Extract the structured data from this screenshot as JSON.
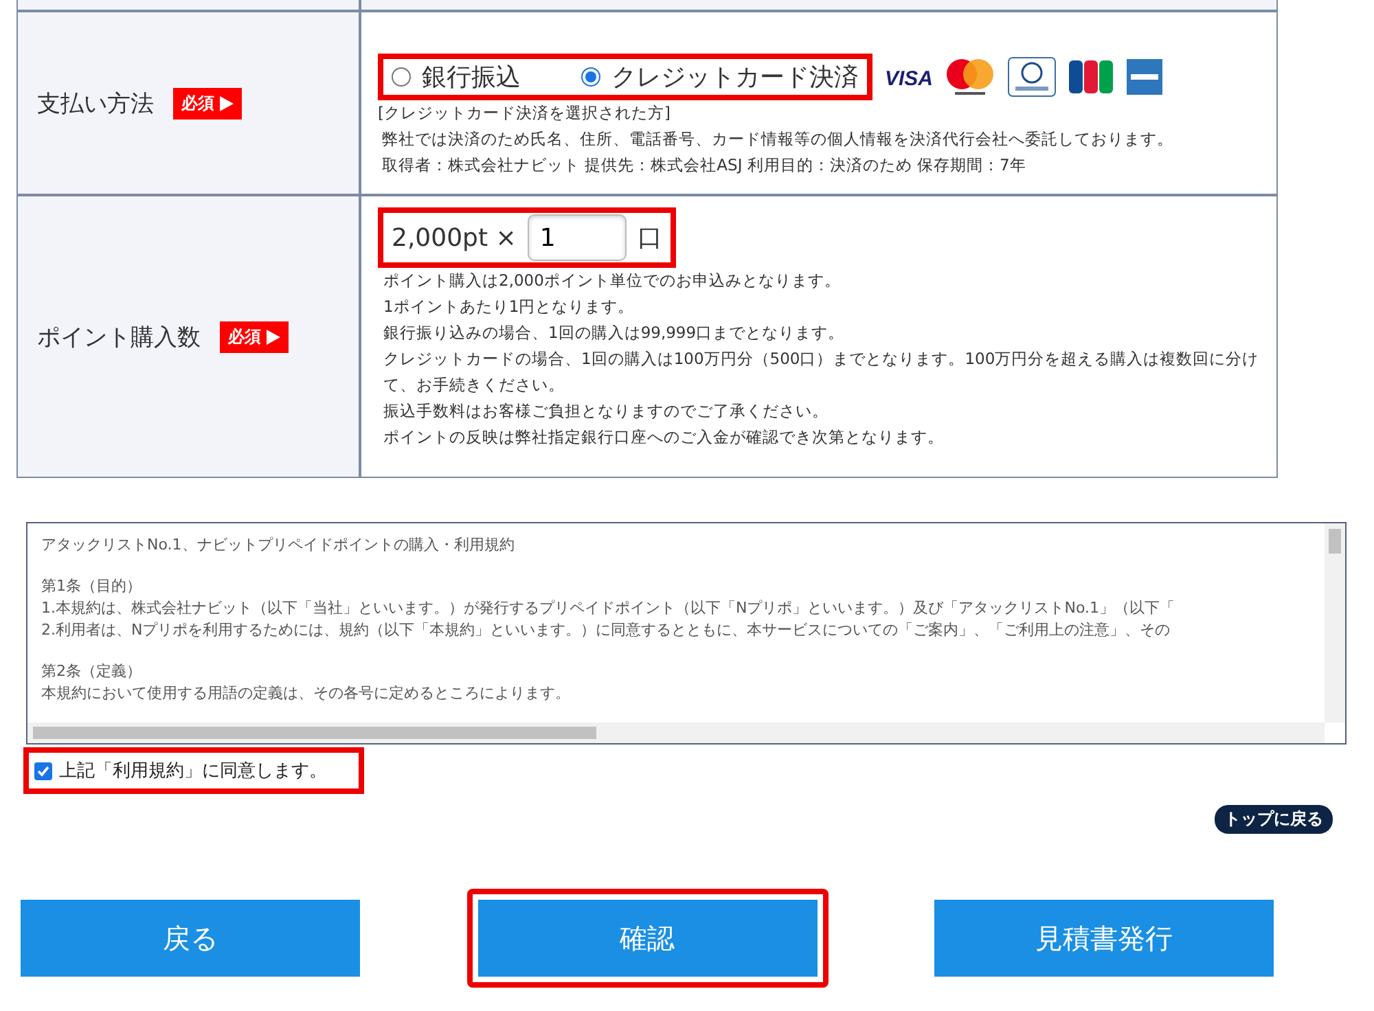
{
  "form_rows": [
    {
      "kind": "payment",
      "label": "支払い方法",
      "required_badge": "必須",
      "options": [
        {
          "label": "銀行振込",
          "selected": false
        },
        {
          "label": "クレジットカード決済",
          "selected": true
        }
      ],
      "card_logos": [
        {
          "kind": "visa",
          "label": "VISA"
        },
        {
          "kind": "mastercard"
        },
        {
          "kind": "diners"
        },
        {
          "kind": "jcb"
        },
        {
          "kind": "amex"
        }
      ],
      "notes": [
        "[クレジットカード決済を選択された方]",
        "弊社では決済のため氏名、住所、電話番号、カード情報等の個人情報を決済代行会社へ委託しております。",
        "取得者：株式会社ナビット 提供先：株式会社ASJ 利用目的：決済のため 保存期間：7年"
      ]
    },
    {
      "kind": "quantity",
      "label": "ポイント購入数",
      "required_badge": "必須",
      "unit_price": "2,000pt ×",
      "value": "1",
      "unit": "口",
      "notes": [
        "ポイント購入は2,000ポイント単位でのお申込みとなります。",
        "1ポイントあたり1円となります。",
        "銀行振り込みの場合、1回の購入は99,999口までとなります。",
        "クレジットカードの場合、1回の購入は100万円分（500口）までとなります。100万円分を超える購入は複数回に分けて、お手続きください。",
        "振込手数料はお客様ご負担となりますのでご了承ください。",
        "ポイントの反映は弊社指定銀行口座へのご入金が確認でき次第となります。"
      ]
    }
  ],
  "terms": {
    "paragraphs": [
      [
        "アタックリストNo.1、ナビットプリペイドポイントの購入・利用規約"
      ],
      [
        "第1条（目的）",
        "1.本規約は、株式会社ナビット（以下「当社」といいます。）が発行するプリペイドポイント（以下「Nプリポ」といいます。）及び「アタックリストNo.1」（以下「",
        "2.利用者は、Nプリポを利用するためには、規約（以下「本規約」といいます。）に同意するとともに、本サービスについての「ご案内」、「ご利用上の注意」、その"
      ],
      [
        "第2条（定義）",
        "本規約において使用する用語の定義は、その各号に定めるところによります。"
      ]
    ]
  },
  "agree": {
    "label": "上記「利用規約」に同意します。",
    "checked": true
  },
  "back_to_top": "トップに戻る",
  "buttons": [
    {
      "label": "戻る",
      "highlighted": false
    },
    {
      "label": "確認",
      "highlighted": true
    },
    {
      "label": "見積書発行",
      "highlighted": false
    }
  ]
}
